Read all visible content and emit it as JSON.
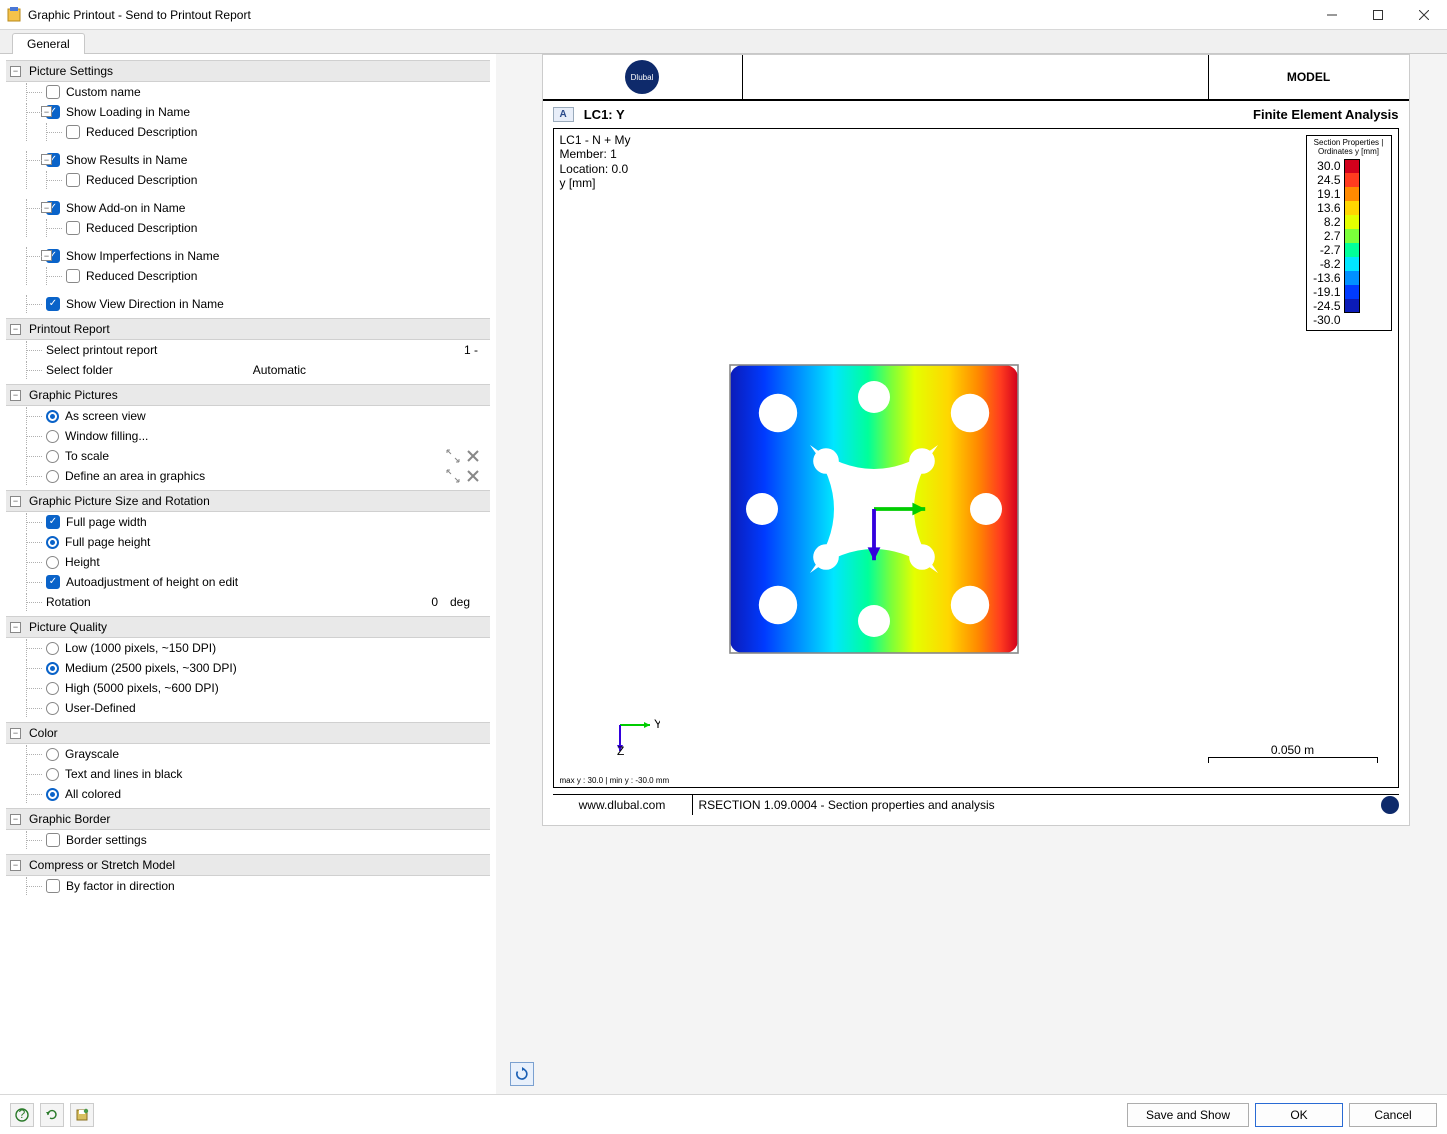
{
  "window": {
    "title": "Graphic Printout - Send to Printout Report"
  },
  "tab": {
    "general": "General"
  },
  "sections": {
    "picture_settings": {
      "title": "Picture Settings",
      "custom_name": "Custom name",
      "show_loading": "Show Loading in Name",
      "reduced_desc": "Reduced Description",
      "show_results": "Show Results in Name",
      "show_addon": "Show Add-on in Name",
      "show_imperf": "Show Imperfections in Name",
      "show_view_dir": "Show View Direction in Name"
    },
    "printout_report": {
      "title": "Printout Report",
      "select_report": "Select printout report",
      "select_report_val": "1 -",
      "select_folder": "Select folder",
      "select_folder_val": "Automatic"
    },
    "graphic_pictures": {
      "title": "Graphic Pictures",
      "as_screen": "As screen view",
      "window_fill": "Window filling...",
      "to_scale": "To scale",
      "define_area": "Define an area in graphics"
    },
    "size_rot": {
      "title": "Graphic Picture Size and Rotation",
      "full_width": "Full page width",
      "full_height": "Full page height",
      "height": "Height",
      "autoadjust": "Autoadjustment of height on edit",
      "rotation": "Rotation",
      "rotation_val": "0",
      "rotation_unit": "deg"
    },
    "quality": {
      "title": "Picture Quality",
      "low": "Low (1000 pixels, ~150 DPI)",
      "medium": "Medium (2500 pixels, ~300 DPI)",
      "high": "High (5000 pixels, ~600 DPI)",
      "user": "User-Defined"
    },
    "color": {
      "title": "Color",
      "grayscale": "Grayscale",
      "text_black": "Text and lines in black",
      "all_colored": "All colored"
    },
    "border": {
      "title": "Graphic Border",
      "border_settings": "Border settings"
    },
    "compress": {
      "title": "Compress or Stretch Model",
      "by_factor": "By factor in direction"
    }
  },
  "preview": {
    "header_logo": "Dlubal",
    "header_model": "MODEL",
    "badge": "A",
    "chart_title": "LC1: Y",
    "subtitle": "Finite Element Analysis",
    "info_lines": [
      "LC1 - N + My",
      "Member: 1",
      "Location: 0.0",
      "y [mm]"
    ],
    "legend_title": "Section Properties | Ordinates y [mm]",
    "legend_vals": [
      "30.0",
      "24.5",
      "19.1",
      "13.6",
      "8.2",
      "2.7",
      "-2.7",
      "-8.2",
      "-13.6",
      "-19.1",
      "-24.5",
      "-30.0"
    ],
    "legend_colors": [
      "#d2001c",
      "#ff3b1f",
      "#ff8a00",
      "#ffd600",
      "#e4ff00",
      "#7bff3a",
      "#00ff9a",
      "#00e6ff",
      "#0090ff",
      "#003bff",
      "#0b1bb8"
    ],
    "axis_y": "Y",
    "axis_z": "Z",
    "scale_label": "0.050 m",
    "chart_footer": "max y : 30.0 | min y : -30.0 mm",
    "footer_url": "www.dlubal.com",
    "footer_app": "RSECTION 1.09.0004 - Section properties and analysis"
  },
  "buttons": {
    "save_show": "Save and Show",
    "ok": "OK",
    "cancel": "Cancel"
  }
}
